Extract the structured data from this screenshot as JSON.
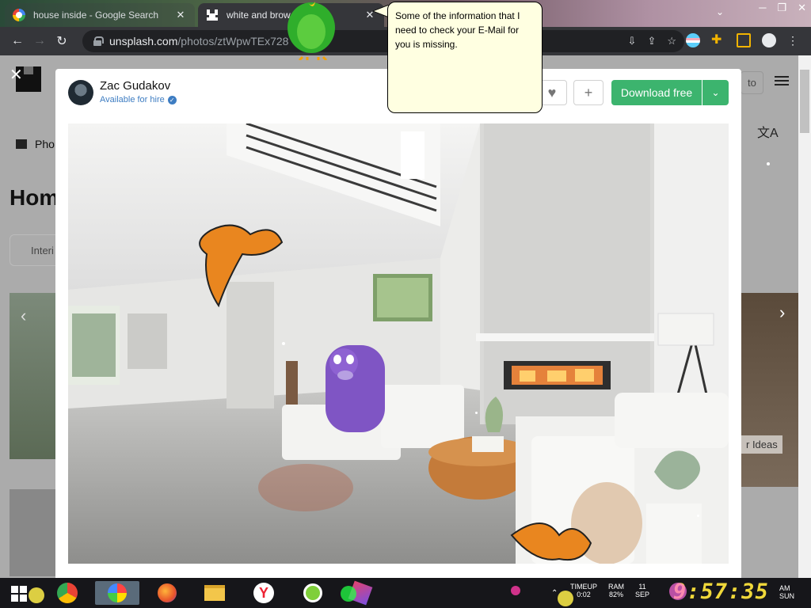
{
  "browser": {
    "tabs": [
      {
        "title": "house inside - Google Search",
        "favicon": "google-icon",
        "active": false
      },
      {
        "title": "white and brow",
        "favicon": "unsplash-icon",
        "active": true
      }
    ],
    "url_host": "unsplash.com",
    "url_path": "/photos/ztWpwTEx728",
    "tab_close": "✕",
    "minimize": "─",
    "maximize": "❐",
    "close": "✕",
    "tab_dropdown": "⌄"
  },
  "bonzi_balloon": {
    "text": "Some of the information that I need to check your E-Mail for you is missing."
  },
  "background_page": {
    "tab_photos": "Pho",
    "heading": "Hom",
    "chip": "Interi",
    "login": "to",
    "ideas_label": "r Ideas"
  },
  "modal": {
    "author_name": "Zac Gudakov",
    "hire_label": "Available for hire",
    "download_label": "Download free",
    "like_icon": "heart-icon",
    "add_icon": "plus-icon"
  },
  "taskbar": {
    "timeup_label": "TIMEUP",
    "timeup_value": "0:02",
    "ram_label": "RAM",
    "ram_value": "82%",
    "date_day": "11",
    "date_month": "SEP",
    "clock": "9:57:35",
    "ampm": "AM",
    "weekday": "SUN"
  },
  "colors": {
    "download_green": "#3cb46e",
    "balloon_bg": "#ffffe1",
    "clock_yellow": "#f0d83a",
    "verified_blue": "#3e7dc2"
  }
}
